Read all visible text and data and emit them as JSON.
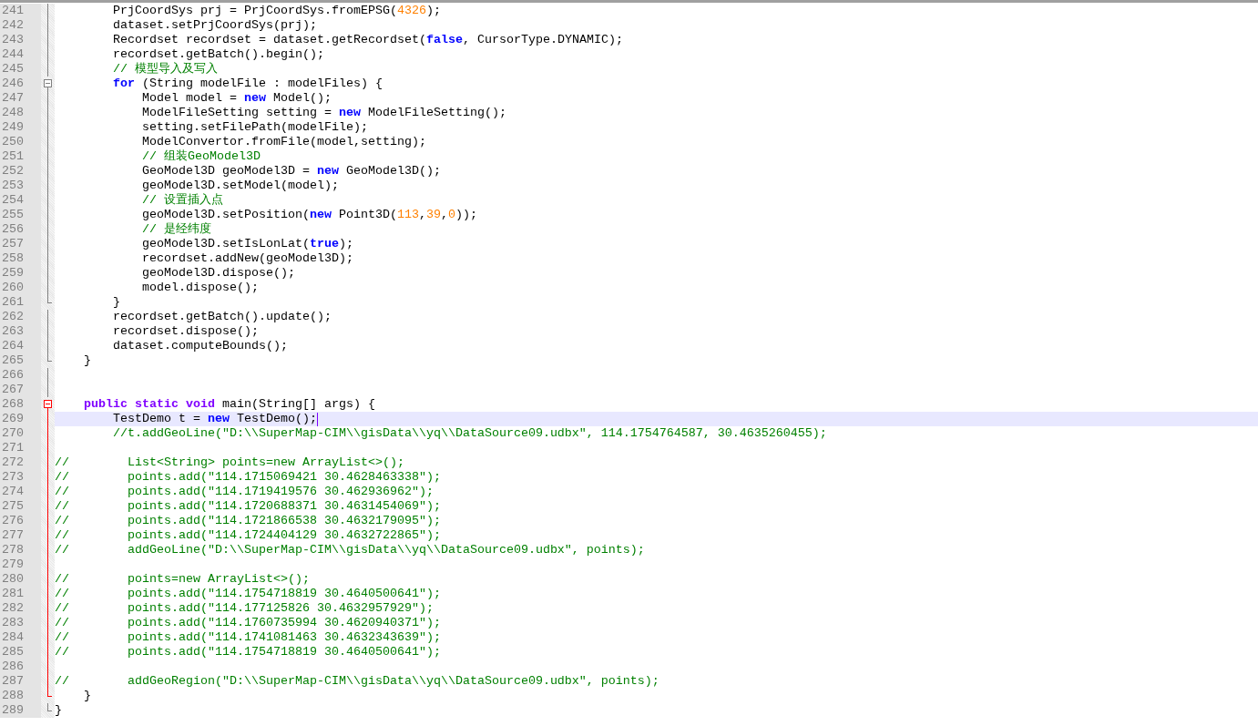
{
  "editor": {
    "lines": [
      {
        "number": "241",
        "fold": {
          "kind": "line",
          "highlight": false
        },
        "current": false,
        "tokens": [
          {
            "kind": "plain",
            "text": "        PrjCoordSys prj = PrjCoordSys.fromEPSG("
          },
          {
            "kind": "number",
            "text": "4326"
          },
          {
            "kind": "plain",
            "text": ");"
          }
        ]
      },
      {
        "number": "242",
        "fold": {
          "kind": "line",
          "highlight": false
        },
        "current": false,
        "tokens": [
          {
            "kind": "plain",
            "text": "        dataset.setPrjCoordSys(prj);"
          }
        ]
      },
      {
        "number": "243",
        "fold": {
          "kind": "line",
          "highlight": false
        },
        "current": false,
        "tokens": [
          {
            "kind": "plain",
            "text": "        Recordset recordset = dataset.getRecordset("
          },
          {
            "kind": "keyword",
            "text": "false"
          },
          {
            "kind": "plain",
            "text": ", CursorType.DYNAMIC);"
          }
        ]
      },
      {
        "number": "244",
        "fold": {
          "kind": "line",
          "highlight": false
        },
        "current": false,
        "tokens": [
          {
            "kind": "plain",
            "text": "        recordset.getBatch().begin();"
          }
        ]
      },
      {
        "number": "245",
        "fold": {
          "kind": "line",
          "highlight": false
        },
        "current": false,
        "tokens": [
          {
            "kind": "comment",
            "text": "        // 模型导入及写入"
          }
        ]
      },
      {
        "number": "246",
        "fold": {
          "kind": "box",
          "highlight": false
        },
        "current": false,
        "tokens": [
          {
            "kind": "keyword",
            "text": "        for"
          },
          {
            "kind": "plain",
            "text": " (String modelFile : modelFiles) {"
          }
        ]
      },
      {
        "number": "247",
        "fold": {
          "kind": "line",
          "highlight": false
        },
        "current": false,
        "tokens": [
          {
            "kind": "plain",
            "text": "            Model model = "
          },
          {
            "kind": "keyword",
            "text": "new"
          },
          {
            "kind": "plain",
            "text": " Model();"
          }
        ]
      },
      {
        "number": "248",
        "fold": {
          "kind": "line",
          "highlight": false
        },
        "current": false,
        "tokens": [
          {
            "kind": "plain",
            "text": "            ModelFileSetting setting = "
          },
          {
            "kind": "keyword",
            "text": "new"
          },
          {
            "kind": "plain",
            "text": " ModelFileSetting();"
          }
        ]
      },
      {
        "number": "249",
        "fold": {
          "kind": "line",
          "highlight": false
        },
        "current": false,
        "tokens": [
          {
            "kind": "plain",
            "text": "            setting.setFilePath(modelFile);"
          }
        ]
      },
      {
        "number": "250",
        "fold": {
          "kind": "line",
          "highlight": false
        },
        "current": false,
        "tokens": [
          {
            "kind": "plain",
            "text": "            ModelConvertor.fromFile(model,setting);"
          }
        ]
      },
      {
        "number": "251",
        "fold": {
          "kind": "line",
          "highlight": false
        },
        "current": false,
        "tokens": [
          {
            "kind": "comment",
            "text": "            // 组装GeoModel3D"
          }
        ]
      },
      {
        "number": "252",
        "fold": {
          "kind": "line",
          "highlight": false
        },
        "current": false,
        "tokens": [
          {
            "kind": "plain",
            "text": "            GeoModel3D geoModel3D = "
          },
          {
            "kind": "keyword",
            "text": "new"
          },
          {
            "kind": "plain",
            "text": " GeoModel3D();"
          }
        ]
      },
      {
        "number": "253",
        "fold": {
          "kind": "line",
          "highlight": false
        },
        "current": false,
        "tokens": [
          {
            "kind": "plain",
            "text": "            geoModel3D.setModel(model);"
          }
        ]
      },
      {
        "number": "254",
        "fold": {
          "kind": "line",
          "highlight": false
        },
        "current": false,
        "tokens": [
          {
            "kind": "comment",
            "text": "            // 设置插入点"
          }
        ]
      },
      {
        "number": "255",
        "fold": {
          "kind": "line",
          "highlight": false
        },
        "current": false,
        "tokens": [
          {
            "kind": "plain",
            "text": "            geoModel3D.setPosition("
          },
          {
            "kind": "keyword",
            "text": "new"
          },
          {
            "kind": "plain",
            "text": " Point3D("
          },
          {
            "kind": "number",
            "text": "113"
          },
          {
            "kind": "plain",
            "text": ","
          },
          {
            "kind": "number",
            "text": "39"
          },
          {
            "kind": "plain",
            "text": ","
          },
          {
            "kind": "number",
            "text": "0"
          },
          {
            "kind": "plain",
            "text": "));"
          }
        ]
      },
      {
        "number": "256",
        "fold": {
          "kind": "line",
          "highlight": false
        },
        "current": false,
        "tokens": [
          {
            "kind": "comment",
            "text": "            // 是经纬度"
          }
        ]
      },
      {
        "number": "257",
        "fold": {
          "kind": "line",
          "highlight": false
        },
        "current": false,
        "tokens": [
          {
            "kind": "plain",
            "text": "            geoModel3D.setIsLonLat("
          },
          {
            "kind": "keyword",
            "text": "true"
          },
          {
            "kind": "plain",
            "text": ");"
          }
        ]
      },
      {
        "number": "258",
        "fold": {
          "kind": "line",
          "highlight": false
        },
        "current": false,
        "tokens": [
          {
            "kind": "plain",
            "text": "            recordset.addNew(geoModel3D);"
          }
        ]
      },
      {
        "number": "259",
        "fold": {
          "kind": "line",
          "highlight": false
        },
        "current": false,
        "tokens": [
          {
            "kind": "plain",
            "text": "            geoModel3D.dispose();"
          }
        ]
      },
      {
        "number": "260",
        "fold": {
          "kind": "line",
          "highlight": false
        },
        "current": false,
        "tokens": [
          {
            "kind": "plain",
            "text": "            model.dispose();"
          }
        ]
      },
      {
        "number": "261",
        "fold": {
          "kind": "end",
          "highlight": false
        },
        "current": false,
        "tokens": [
          {
            "kind": "plain",
            "text": "        }"
          }
        ]
      },
      {
        "number": "262",
        "fold": {
          "kind": "line",
          "highlight": false
        },
        "current": false,
        "tokens": [
          {
            "kind": "plain",
            "text": "        recordset.getBatch().update();"
          }
        ]
      },
      {
        "number": "263",
        "fold": {
          "kind": "line",
          "highlight": false
        },
        "current": false,
        "tokens": [
          {
            "kind": "plain",
            "text": "        recordset.dispose();"
          }
        ]
      },
      {
        "number": "264",
        "fold": {
          "kind": "line",
          "highlight": false
        },
        "current": false,
        "tokens": [
          {
            "kind": "plain",
            "text": "        dataset.computeBounds();"
          }
        ]
      },
      {
        "number": "265",
        "fold": {
          "kind": "end",
          "highlight": false
        },
        "current": false,
        "tokens": [
          {
            "kind": "plain",
            "text": "    }"
          }
        ]
      },
      {
        "number": "266",
        "fold": {
          "kind": "line",
          "highlight": false
        },
        "current": false
      },
      {
        "number": "267",
        "fold": {
          "kind": "line",
          "highlight": false
        },
        "current": false
      },
      {
        "number": "268",
        "fold": {
          "kind": "box",
          "highlight": true
        },
        "current": false,
        "tokens": [
          {
            "kind": "modifier",
            "text": "    public static void"
          },
          {
            "kind": "plain",
            "text": " main(String[] args) {"
          }
        ]
      },
      {
        "number": "269",
        "fold": {
          "kind": "line",
          "highlight": true
        },
        "current": true,
        "tokens": [
          {
            "kind": "plain",
            "text": "        TestDemo t = "
          },
          {
            "kind": "keyword",
            "text": "new"
          },
          {
            "kind": "plain",
            "text": " TestDemo();"
          }
        ]
      },
      {
        "number": "270",
        "fold": {
          "kind": "line",
          "highlight": true
        },
        "current": false,
        "tokens": [
          {
            "kind": "comment",
            "text": "        //t.addGeoLine(\"D:\\\\SuperMap-CIM\\\\gisData\\\\yq\\\\DataSource09.udbx\", 114.1754764587, 30.4635260455);"
          }
        ]
      },
      {
        "number": "271",
        "fold": {
          "kind": "line",
          "highlight": true
        },
        "current": false
      },
      {
        "number": "272",
        "fold": {
          "kind": "line",
          "highlight": true
        },
        "current": false,
        "tokens": [
          {
            "kind": "comment",
            "text": "//        List<String> points=new ArrayList<>();"
          }
        ]
      },
      {
        "number": "273",
        "fold": {
          "kind": "line",
          "highlight": true
        },
        "current": false,
        "tokens": [
          {
            "kind": "comment",
            "text": "//        points.add(\"114.1715069421 30.4628463338\");"
          }
        ]
      },
      {
        "number": "274",
        "fold": {
          "kind": "line",
          "highlight": true
        },
        "current": false,
        "tokens": [
          {
            "kind": "comment",
            "text": "//        points.add(\"114.1719419576 30.462936962\");"
          }
        ]
      },
      {
        "number": "275",
        "fold": {
          "kind": "line",
          "highlight": true
        },
        "current": false,
        "tokens": [
          {
            "kind": "comment",
            "text": "//        points.add(\"114.1720688371 30.4631454069\");"
          }
        ]
      },
      {
        "number": "276",
        "fold": {
          "kind": "line",
          "highlight": true
        },
        "current": false,
        "tokens": [
          {
            "kind": "comment",
            "text": "//        points.add(\"114.1721866538 30.4632179095\");"
          }
        ]
      },
      {
        "number": "277",
        "fold": {
          "kind": "line",
          "highlight": true
        },
        "current": false,
        "tokens": [
          {
            "kind": "comment",
            "text": "//        points.add(\"114.1724404129 30.4632722865\");"
          }
        ]
      },
      {
        "number": "278",
        "fold": {
          "kind": "line",
          "highlight": true
        },
        "current": false,
        "tokens": [
          {
            "kind": "comment",
            "text": "//        addGeoLine(\"D:\\\\SuperMap-CIM\\\\gisData\\\\yq\\\\DataSource09.udbx\", points);"
          }
        ]
      },
      {
        "number": "279",
        "fold": {
          "kind": "line",
          "highlight": true
        },
        "current": false
      },
      {
        "number": "280",
        "fold": {
          "kind": "line",
          "highlight": true
        },
        "current": false,
        "tokens": [
          {
            "kind": "comment",
            "text": "//        points=new ArrayList<>();"
          }
        ]
      },
      {
        "number": "281",
        "fold": {
          "kind": "line",
          "highlight": true
        },
        "current": false,
        "tokens": [
          {
            "kind": "comment",
            "text": "//        points.add(\"114.1754718819 30.4640500641\");"
          }
        ]
      },
      {
        "number": "282",
        "fold": {
          "kind": "line",
          "highlight": true
        },
        "current": false,
        "tokens": [
          {
            "kind": "comment",
            "text": "//        points.add(\"114.177125826 30.4632957929\");"
          }
        ]
      },
      {
        "number": "283",
        "fold": {
          "kind": "line",
          "highlight": true
        },
        "current": false,
        "tokens": [
          {
            "kind": "comment",
            "text": "//        points.add(\"114.1760735994 30.4620940371\");"
          }
        ]
      },
      {
        "number": "284",
        "fold": {
          "kind": "line",
          "highlight": true
        },
        "current": false,
        "tokens": [
          {
            "kind": "comment",
            "text": "//        points.add(\"114.1741081463 30.4632343639\");"
          }
        ]
      },
      {
        "number": "285",
        "fold": {
          "kind": "line",
          "highlight": true
        },
        "current": false,
        "tokens": [
          {
            "kind": "comment",
            "text": "//        points.add(\"114.1754718819 30.4640500641\");"
          }
        ]
      },
      {
        "number": "286",
        "fold": {
          "kind": "line",
          "highlight": true
        },
        "current": false
      },
      {
        "number": "287",
        "fold": {
          "kind": "line",
          "highlight": true
        },
        "current": false,
        "tokens": [
          {
            "kind": "comment",
            "text": "//        addGeoRegion(\"D:\\\\SuperMap-CIM\\\\gisData\\\\yq\\\\DataSource09.udbx\", points);"
          }
        ]
      },
      {
        "number": "288",
        "fold": {
          "kind": "end",
          "highlight": true
        },
        "current": false,
        "tokens": [
          {
            "kind": "plain",
            "text": "    }"
          }
        ]
      },
      {
        "number": "289",
        "fold": {
          "kind": "end",
          "highlight": false
        },
        "current": false,
        "tokens": [
          {
            "kind": "plain",
            "text": "}"
          }
        ]
      }
    ]
  }
}
